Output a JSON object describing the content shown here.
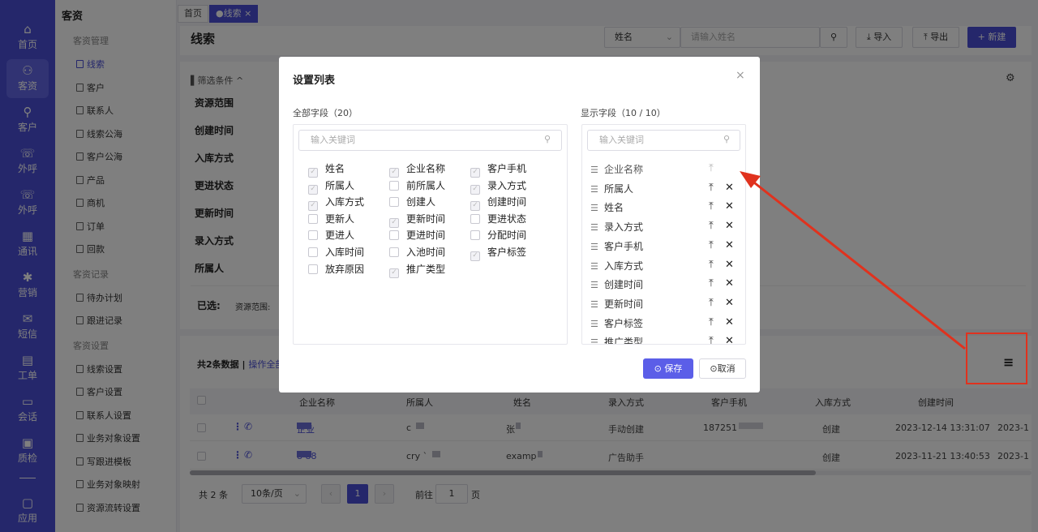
{
  "rail": [
    {
      "icon": "home-icon",
      "glyph": "⌂",
      "label": "首页"
    },
    {
      "icon": "users-icon",
      "glyph": "⚇",
      "label": "客资",
      "active": true
    },
    {
      "icon": "user-icon",
      "glyph": "⚲",
      "label": "客户"
    },
    {
      "icon": "phone-icon",
      "glyph": "☏",
      "label": "外呼"
    },
    {
      "icon": "phone-out-icon",
      "glyph": "☏",
      "label": "外呼"
    },
    {
      "icon": "address-book-icon",
      "glyph": "▦",
      "label": "通讯"
    },
    {
      "icon": "marketing-icon",
      "glyph": "✱",
      "label": "营销"
    },
    {
      "icon": "sms-icon",
      "glyph": "✉",
      "label": "短信"
    },
    {
      "icon": "clipboard-icon",
      "glyph": "▤",
      "label": "工单"
    },
    {
      "icon": "chat-icon",
      "glyph": "▭",
      "label": "会话"
    },
    {
      "icon": "quality-icon",
      "glyph": "▣",
      "label": "质检"
    },
    {
      "icon": "apps-icon",
      "glyph": "▢",
      "label": "应用"
    }
  ],
  "submenu": {
    "title": "客资",
    "groups": [
      {
        "label": "客资管理",
        "items": [
          "线索",
          "客户",
          "联系人",
          "线索公海",
          "客户公海",
          "产品",
          "商机",
          "订单",
          "回款"
        ]
      },
      {
        "label": "客资记录",
        "items": [
          "待办计划",
          "跟进记录"
        ]
      },
      {
        "label": "客资设置",
        "items": [
          "线索设置",
          "客户设置",
          "联系人设置",
          "业务对象设置",
          "写跟进模板",
          "业务对象映射",
          "资源流转设置"
        ]
      }
    ]
  },
  "tabs": {
    "home": "首页",
    "current": "●线索 ×"
  },
  "page": {
    "title": "线索",
    "search_select": "姓名",
    "search_placeholder": "请输入姓名",
    "import": "导入",
    "export": "导出",
    "new": "+ 新建"
  },
  "filter": {
    "toggle": "▌筛选条件 ^",
    "rows": [
      "资源范围",
      "创建时间",
      "入库方式",
      "更进状态",
      "更新时间",
      "录入方式",
      "所属人"
    ],
    "selected_label": "已选:",
    "selected_value": "资源范围:"
  },
  "table": {
    "summary": "共2条数据",
    "sep": "|",
    "ops": "操作全部",
    "headers": [
      "企业名称",
      "所属人",
      "姓名",
      "录入方式",
      "客户手机",
      "入库方式",
      "创建时间"
    ],
    "rows": [
      {
        "company": "企业",
        "owner": "c",
        "name": "张",
        "entry": "手动创建",
        "phone": "187251",
        "storage": "创建",
        "created": "2023-12-14 13:31:07",
        "extra": "2023-1"
      },
      {
        "company": "8 88",
        "owner": "cry `",
        "name": "examp",
        "entry": "广告助手",
        "phone": "",
        "storage": "创建",
        "created": "2023-11-21 13:40:53",
        "extra": "2023-1"
      }
    ]
  },
  "pager": {
    "total": "共 2 条",
    "size": "10条/页",
    "page": "1",
    "goto": "前往",
    "goto_value": "1",
    "page_suffix": "页"
  },
  "modal": {
    "title": "设置列表",
    "all_label": "全部字段（20）",
    "shown_label": "显示字段（10 / 10）",
    "search_placeholder": "输入关键词",
    "all_fields": [
      {
        "label": "姓名",
        "checked": true
      },
      {
        "label": "企业名称",
        "checked": true
      },
      {
        "label": "客户手机",
        "checked": true
      },
      {
        "label": "所属人",
        "checked": true
      },
      {
        "label": "前所属人",
        "checked": false
      },
      {
        "label": "录入方式",
        "checked": true
      },
      {
        "label": "入库方式",
        "checked": true
      },
      {
        "label": "创建人",
        "checked": false
      },
      {
        "label": "创建时间",
        "checked": true
      },
      {
        "label": "更新人",
        "checked": false
      },
      {
        "label": "更新时间",
        "checked": true
      },
      {
        "label": "更进状态",
        "checked": false
      },
      {
        "label": "更进人",
        "checked": false
      },
      {
        "label": "更进时间",
        "checked": false
      },
      {
        "label": "分配时间",
        "checked": false
      },
      {
        "label": "入库时间",
        "checked": false
      },
      {
        "label": "入池时间",
        "checked": false
      },
      {
        "label": "客户标签",
        "checked": true
      },
      {
        "label": "放弃原因",
        "checked": false
      },
      {
        "label": "推广类型",
        "checked": true
      }
    ],
    "shown_fields": [
      "企业名称",
      "所属人",
      "姓名",
      "录入方式",
      "客户手机",
      "入库方式",
      "创建时间",
      "更新时间",
      "客户标签",
      "推广类型"
    ],
    "save": "保存",
    "cancel": "取消"
  },
  "colors": {
    "brand": "#4b4fd6",
    "annotation": "#e0321e"
  }
}
